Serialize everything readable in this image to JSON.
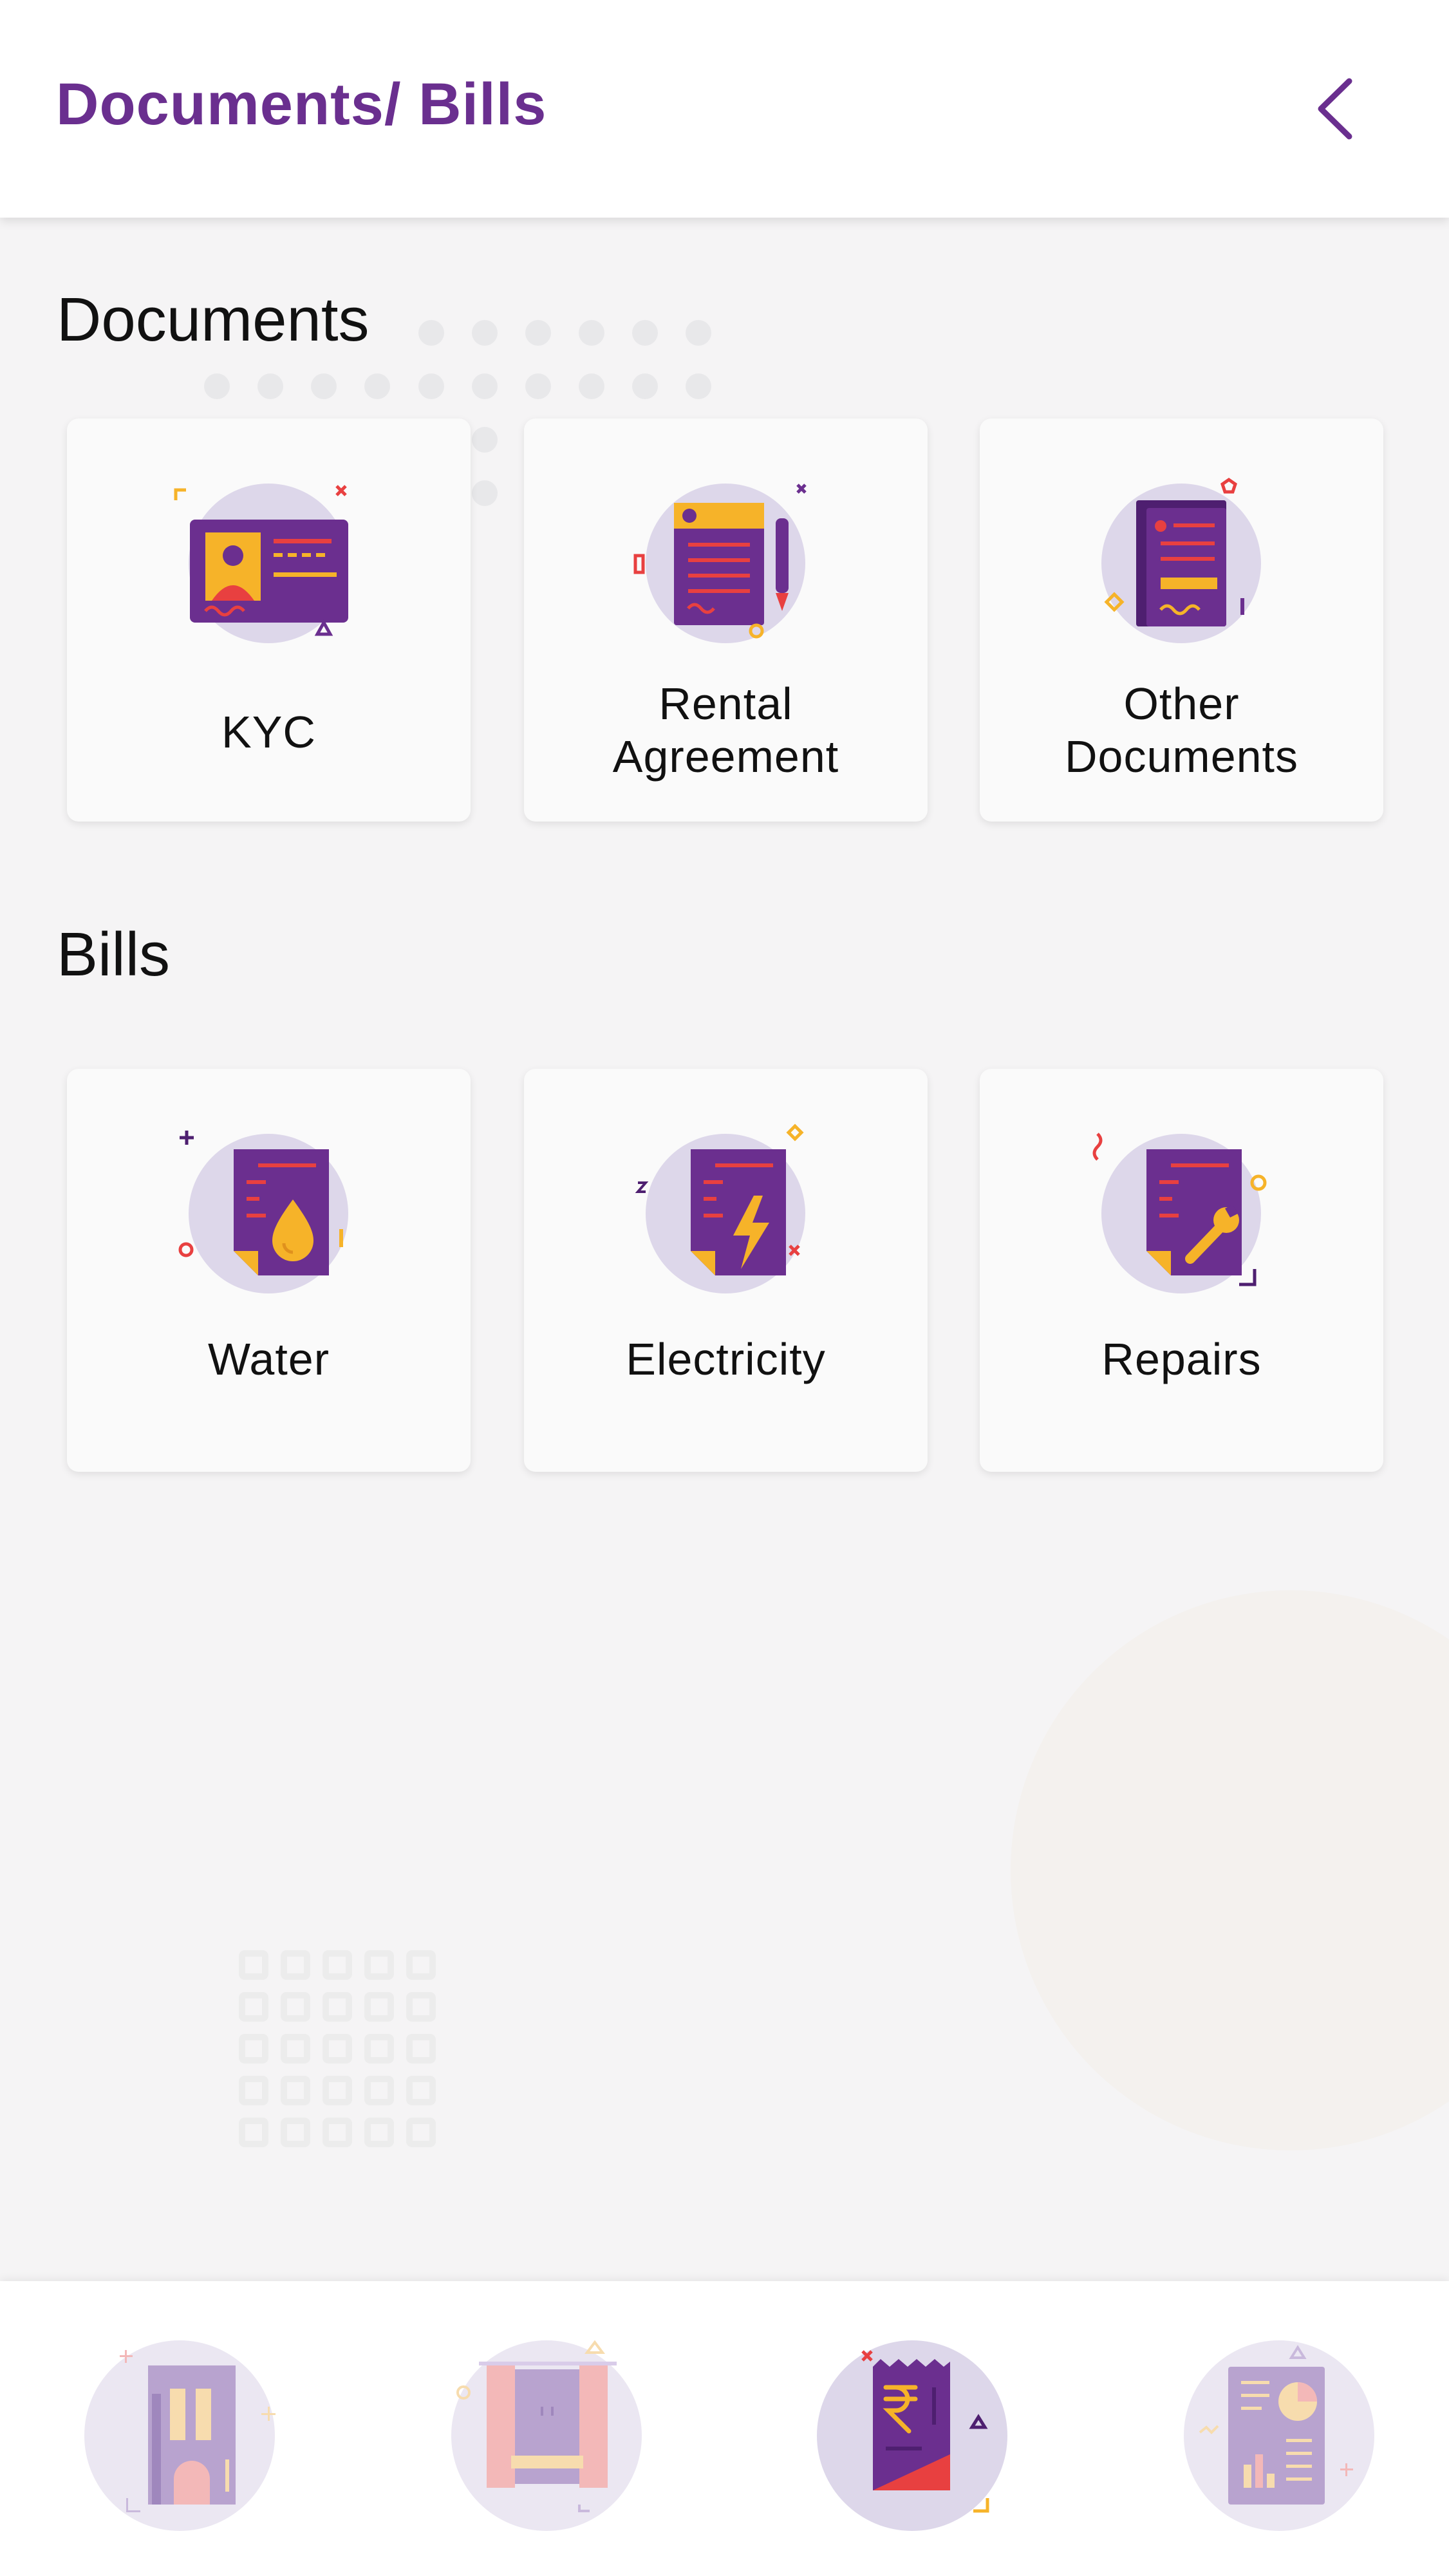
{
  "header": {
    "title": "Documents/ Bills",
    "back_icon": "chevron-left-icon"
  },
  "colors": {
    "accent": "#6a2f8f",
    "icon_purple": "#6b2f8f",
    "icon_yellow": "#f6b329",
    "icon_red": "#e84040",
    "icon_circle": "#ddd7ea",
    "background": "#f5f4f5"
  },
  "sections": {
    "documents": {
      "title": "Documents",
      "items": [
        {
          "label": "KYC",
          "icon": "id-card-icon"
        },
        {
          "label_line1": "Rental",
          "label_line2": "Agreement",
          "icon": "rental-agreement-icon"
        },
        {
          "label_line1": "Other",
          "label_line2": "Documents",
          "icon": "other-documents-icon"
        }
      ]
    },
    "bills": {
      "title": "Bills",
      "items": [
        {
          "label": "Water",
          "icon": "water-bill-icon"
        },
        {
          "label": "Electricity",
          "icon": "electricity-bill-icon"
        },
        {
          "label": "Repairs",
          "icon": "repairs-bill-icon"
        }
      ]
    }
  },
  "bottom_nav": {
    "items": [
      {
        "icon": "building-icon",
        "active": false
      },
      {
        "icon": "room-icon",
        "active": false
      },
      {
        "icon": "rupee-bill-icon",
        "active": true
      },
      {
        "icon": "report-icon",
        "active": false
      }
    ]
  }
}
